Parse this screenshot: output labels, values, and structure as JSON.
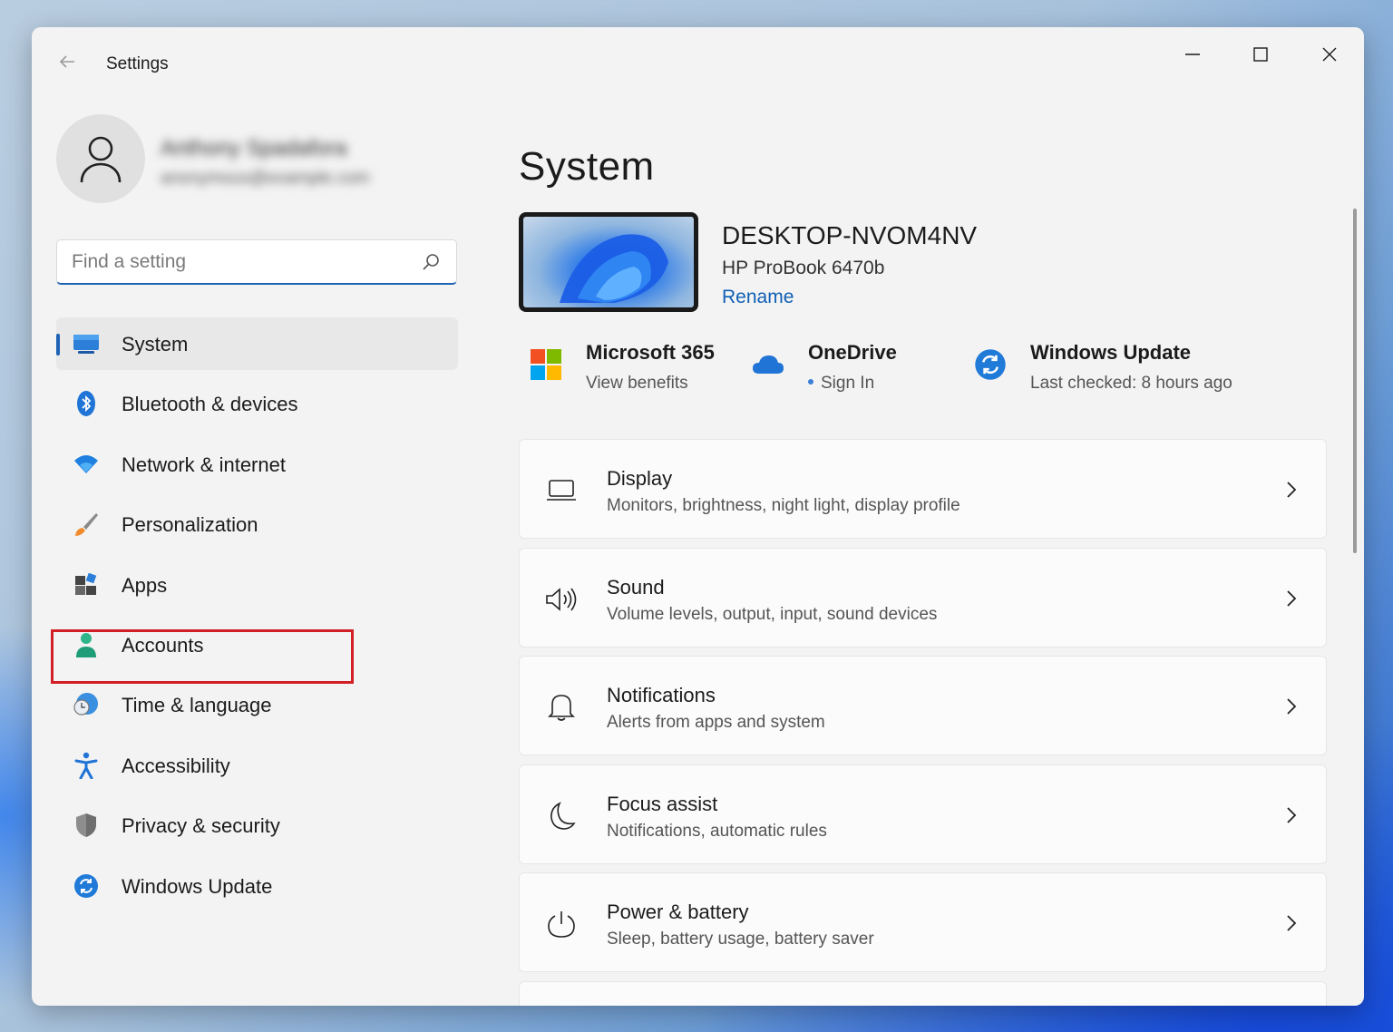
{
  "window": {
    "title": "Settings",
    "controls": {
      "minimize": "minimize-icon",
      "maximize": "maximize-icon",
      "close": "close-icon"
    }
  },
  "profile": {
    "name": "Anthony Spadafora",
    "email": "anonymous@example.com",
    "avatar_icon": "person-icon"
  },
  "search": {
    "placeholder": "Find a setting",
    "value": ""
  },
  "sidebar": {
    "items": [
      {
        "label": "System",
        "icon": "monitor-icon",
        "active": true
      },
      {
        "label": "Bluetooth & devices",
        "icon": "bluetooth-icon",
        "active": false
      },
      {
        "label": "Network & internet",
        "icon": "wifi-icon",
        "active": false
      },
      {
        "label": "Personalization",
        "icon": "brush-icon",
        "active": false
      },
      {
        "label": "Apps",
        "icon": "apps-icon",
        "active": false,
        "highlighted": true
      },
      {
        "label": "Accounts",
        "icon": "person-icon",
        "active": false
      },
      {
        "label": "Time & language",
        "icon": "clock-globe-icon",
        "active": false
      },
      {
        "label": "Accessibility",
        "icon": "accessibility-icon",
        "active": false
      },
      {
        "label": "Privacy & security",
        "icon": "shield-icon",
        "active": false
      },
      {
        "label": "Windows Update",
        "icon": "update-icon",
        "active": false
      }
    ]
  },
  "main": {
    "title": "System",
    "device": {
      "name": "DESKTOP-NVOM4NV",
      "model": "HP ProBook 6470b",
      "rename_label": "Rename"
    },
    "quick": [
      {
        "title": "Microsoft 365",
        "subtitle": "View benefits",
        "icon": "microsoft-logo-icon"
      },
      {
        "title": "OneDrive",
        "subtitle": "Sign In",
        "icon": "cloud-icon"
      },
      {
        "title": "Windows Update",
        "subtitle": "Last checked: 8 hours ago",
        "icon": "update-icon"
      }
    ],
    "cards": [
      {
        "title": "Display",
        "subtitle": "Monitors, brightness, night light, display profile",
        "icon": "laptop-icon"
      },
      {
        "title": "Sound",
        "subtitle": "Volume levels, output, input, sound devices",
        "icon": "speaker-icon"
      },
      {
        "title": "Notifications",
        "subtitle": "Alerts from apps and system",
        "icon": "bell-icon"
      },
      {
        "title": "Focus assist",
        "subtitle": "Notifications, automatic rules",
        "icon": "moon-icon"
      },
      {
        "title": "Power & battery",
        "subtitle": "Sleep, battery usage, battery saver",
        "icon": "power-icon"
      }
    ]
  },
  "colors": {
    "accent": "#1e62b5",
    "link": "#0f5fb5",
    "highlight_box": "#d21f25",
    "window_bg": "#f3f3f3"
  }
}
